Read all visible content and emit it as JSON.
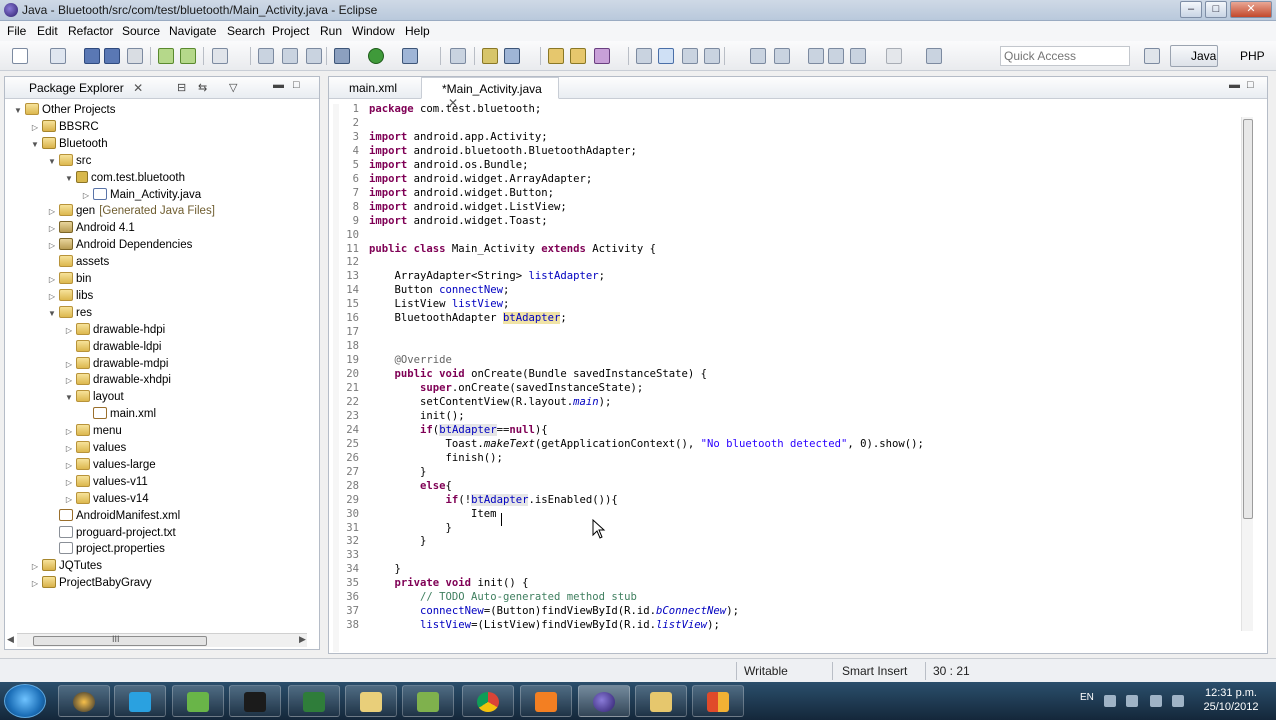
{
  "window": {
    "title": "Java - Bluetooth/src/com/test/bluetooth/Main_Activity.java - Eclipse",
    "min_label": "–",
    "max_label": "□",
    "close_label": "✕"
  },
  "menu": [
    "File",
    "Edit",
    "Refactor",
    "Source",
    "Navigate",
    "Search",
    "Project",
    "Run",
    "Window",
    "Help"
  ],
  "toolbar": {
    "quick_access_placeholder": "Quick Access",
    "perspective_java": "Java",
    "perspective_php": "PHP"
  },
  "explorer": {
    "tab_label": "Package Explorer",
    "tree": [
      {
        "label": "Other Projects",
        "depth": 0,
        "icon": "working-set-icon",
        "twisty": "▼"
      },
      {
        "label": "BBSRC",
        "depth": 1,
        "icon": "project-icon",
        "twisty": "▷"
      },
      {
        "label": "Bluetooth",
        "depth": 1,
        "icon": "android-project-icon",
        "twisty": "▼"
      },
      {
        "label": "src",
        "depth": 2,
        "icon": "source-folder-icon",
        "twisty": "▼"
      },
      {
        "label": "com.test.bluetooth",
        "depth": 3,
        "icon": "package-icon",
        "twisty": "▼"
      },
      {
        "label": "Main_Activity.java",
        "depth": 4,
        "icon": "java-file-icon",
        "twisty": "▷"
      },
      {
        "label": "gen",
        "note": "[Generated Java Files]",
        "depth": 2,
        "icon": "source-folder-icon",
        "twisty": "▷"
      },
      {
        "label": "Android 4.1",
        "depth": 2,
        "icon": "library-icon",
        "twisty": "▷"
      },
      {
        "label": "Android Dependencies",
        "depth": 2,
        "icon": "library-icon",
        "twisty": "▷"
      },
      {
        "label": "assets",
        "depth": 2,
        "icon": "folder-icon",
        "twisty": ""
      },
      {
        "label": "bin",
        "depth": 2,
        "icon": "folder-icon",
        "twisty": "▷"
      },
      {
        "label": "libs",
        "depth": 2,
        "icon": "folder-icon",
        "twisty": "▷"
      },
      {
        "label": "res",
        "depth": 2,
        "icon": "folder-icon",
        "twisty": "▼"
      },
      {
        "label": "drawable-hdpi",
        "depth": 3,
        "icon": "folder-icon",
        "twisty": "▷"
      },
      {
        "label": "drawable-ldpi",
        "depth": 3,
        "icon": "folder-icon",
        "twisty": ""
      },
      {
        "label": "drawable-mdpi",
        "depth": 3,
        "icon": "folder-icon",
        "twisty": "▷"
      },
      {
        "label": "drawable-xhdpi",
        "depth": 3,
        "icon": "folder-icon",
        "twisty": "▷"
      },
      {
        "label": "layout",
        "depth": 3,
        "icon": "folder-icon",
        "twisty": "▼"
      },
      {
        "label": "main.xml",
        "depth": 4,
        "icon": "xml-file-icon",
        "twisty": ""
      },
      {
        "label": "menu",
        "depth": 3,
        "icon": "folder-icon",
        "twisty": "▷"
      },
      {
        "label": "values",
        "depth": 3,
        "icon": "folder-icon",
        "twisty": "▷"
      },
      {
        "label": "values-large",
        "depth": 3,
        "icon": "folder-icon",
        "twisty": "▷"
      },
      {
        "label": "values-v11",
        "depth": 3,
        "icon": "folder-icon",
        "twisty": "▷"
      },
      {
        "label": "values-v14",
        "depth": 3,
        "icon": "folder-icon",
        "twisty": "▷"
      },
      {
        "label": "AndroidManifest.xml",
        "depth": 2,
        "icon": "xml-file-icon",
        "twisty": ""
      },
      {
        "label": "proguard-project.txt",
        "depth": 2,
        "icon": "text-file-icon",
        "twisty": ""
      },
      {
        "label": "project.properties",
        "depth": 2,
        "icon": "text-file-icon",
        "twisty": ""
      },
      {
        "label": "JQTutes",
        "depth": 1,
        "icon": "project-icon",
        "twisty": "▷"
      },
      {
        "label": "ProjectBabyGravy",
        "depth": 1,
        "icon": "project-icon",
        "twisty": "▷"
      }
    ],
    "scroll_thumb_label": "III"
  },
  "editor": {
    "tabs": [
      {
        "label": "main.xml",
        "active": false
      },
      {
        "label": "*Main_Activity.java",
        "active": true
      }
    ],
    "lines": [
      {
        "n": "1",
        "html": "<span class=\"kw\">package</span> com.test.bluetooth;"
      },
      {
        "n": "2",
        "html": ""
      },
      {
        "n": "3",
        "html": "<span class=\"kw\">import</span> android.app.Activity;"
      },
      {
        "n": "4",
        "html": "<span class=\"kw\">import</span> android.bluetooth.BluetoothAdapter;"
      },
      {
        "n": "5",
        "html": "<span class=\"kw\">import</span> android.os.Bundle;"
      },
      {
        "n": "6",
        "html": "<span class=\"kw\">import</span> android.widget.ArrayAdapter;"
      },
      {
        "n": "7",
        "html": "<span class=\"kw\">import</span> android.widget.Button;"
      },
      {
        "n": "8",
        "html": "<span class=\"kw\">import</span> android.widget.ListView;"
      },
      {
        "n": "9",
        "html": "<span class=\"kw\">import</span> android.widget.Toast;"
      },
      {
        "n": "10",
        "html": ""
      },
      {
        "n": "11",
        "html": "<span class=\"kw\">public class</span> Main_Activity <span class=\"kw\">extends</span> Activity {"
      },
      {
        "n": "12",
        "html": ""
      },
      {
        "n": "13",
        "html": "    ArrayAdapter&lt;String&gt; <span class=\"fld\">listAdapter</span>;"
      },
      {
        "n": "14",
        "html": "    Button <span class=\"fld\">connectNew</span>;"
      },
      {
        "n": "15",
        "html": "    ListView <span class=\"fld\">listView</span>;"
      },
      {
        "n": "16",
        "html": "    BluetoothAdapter <span class=\"fld\" style=\"background:#f0e3a6\">btAdapter</span>;"
      },
      {
        "n": "17",
        "html": ""
      },
      {
        "n": "18",
        "html": ""
      },
      {
        "n": "19",
        "html": "    <span class=\"ann\">@Override</span>"
      },
      {
        "n": "20",
        "html": "    <span class=\"kw\">public void</span> onCreate(Bundle savedInstanceState) {"
      },
      {
        "n": "21",
        "html": "        <span class=\"kw\">super</span>.onCreate(savedInstanceState);"
      },
      {
        "n": "22",
        "html": "        setContentView(R.layout.<span class=\"fld it\">main</span>);"
      },
      {
        "n": "23",
        "html": "        init();"
      },
      {
        "n": "24",
        "html": "        <span class=\"kw\">if</span>(<span class=\"fld\" style=\"background:#e6e6e6\">btAdapter</span>==<span class=\"kw\">null</span>){"
      },
      {
        "n": "25",
        "html": "            Toast.<span class=\"it\">makeText</span>(getApplicationContext(), <span class=\"str\">\"No bluetooth detected\"</span>, 0).show();"
      },
      {
        "n": "26",
        "html": "            finish();"
      },
      {
        "n": "27",
        "html": "        }"
      },
      {
        "n": "28",
        "html": "        <span class=\"kw\">else</span>{"
      },
      {
        "n": "29",
        "html": "            <span class=\"kw\">if</span>(!<span class=\"fld\" style=\"background:#e6e6e6\">btAdapter</span>.isEnabled()){"
      },
      {
        "n": "30",
        "html": "                Item"
      },
      {
        "n": "31",
        "html": "            }"
      },
      {
        "n": "32",
        "html": "        }"
      },
      {
        "n": "33",
        "html": ""
      },
      {
        "n": "34",
        "html": "    }"
      },
      {
        "n": "35",
        "html": "    <span class=\"kw\">private void</span> init() {"
      },
      {
        "n": "36",
        "html": "        <span class=\"cmt\">// TODO Auto-generated method stub</span>"
      },
      {
        "n": "37",
        "html": "        <span class=\"fld\">connectNew</span>=(Button)findViewById(R.id.<span class=\"fld it\">bConnectNew</span>);"
      },
      {
        "n": "38",
        "html": "        <span class=\"fld\">listView</span>=(ListView)findViewById(R.id.<span class=\"fld it\">listView</span>);"
      }
    ]
  },
  "status": {
    "writable": "Writable",
    "insert_mode": "Smart Insert",
    "position": "30 : 21"
  },
  "taskbar": {
    "lang": "EN",
    "time": "12:31 p.m.",
    "date": "25/10/2012"
  }
}
